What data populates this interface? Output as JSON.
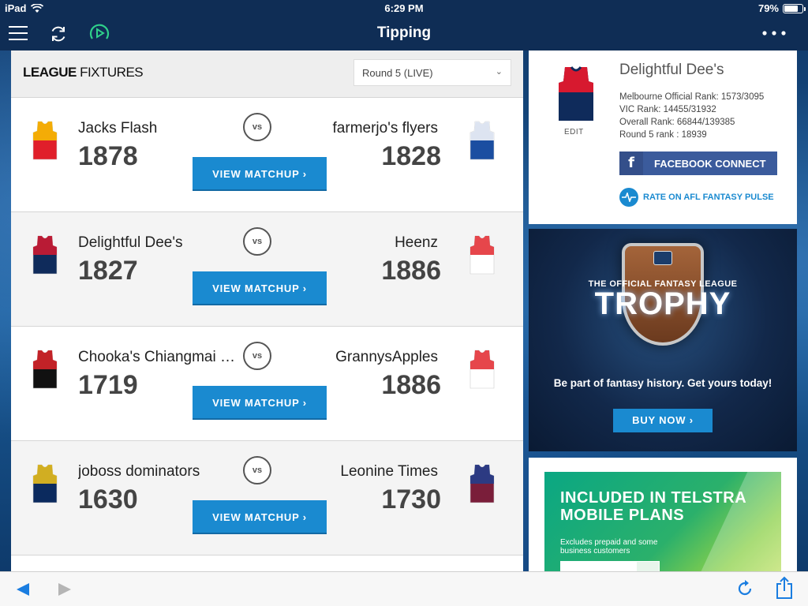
{
  "status_bar": {
    "device": "iPad",
    "time": "6:29 PM",
    "battery": "79%",
    "battery_level": 0.79
  },
  "app_bar": {
    "title": "Tipping",
    "icons": [
      "menu-icon",
      "refresh-icon",
      "play-icon",
      "more-icon"
    ]
  },
  "fixtures": {
    "title_bold": "LEAGUE",
    "title_rest": " FIXTURES",
    "round_select": "Round 5 (LIVE)",
    "vs_label": "vs",
    "button_label": "VIEW MATCHUP ›",
    "matches": [
      {
        "home": {
          "name": "Jacks Flash",
          "score": "1878",
          "jersey_colors": [
            "#e01f2a",
            "#f7c600"
          ]
        },
        "away": {
          "name": "farmerjo's flyers",
          "score": "1828",
          "jersey_colors": [
            "#1b4ea1",
            "#ffffff"
          ]
        }
      },
      {
        "home": {
          "name": "Delightful Dee's",
          "score": "1827",
          "jersey_colors": [
            "#0f2b5b",
            "#d7192f"
          ]
        },
        "away": {
          "name": "Heenz",
          "score": "1886",
          "jersey_colors": [
            "#ffffff",
            "#e2262b"
          ]
        }
      },
      {
        "home": {
          "name": "Chooka's Chiangmai Sa...",
          "score": "1719",
          "jersey_colors": [
            "#111111",
            "#e2262b"
          ]
        },
        "away": {
          "name": "GrannysApples",
          "score": "1886",
          "jersey_colors": [
            "#ffffff",
            "#e2262b"
          ]
        }
      },
      {
        "home": {
          "name": "joboss dominators",
          "score": "1630",
          "jersey_colors": [
            "#0b2a5e",
            "#f5c518"
          ]
        },
        "away": {
          "name": "Leonine Times",
          "score": "1730",
          "jersey_colors": [
            "#7a1e3a",
            "#1f3f8f"
          ]
        }
      }
    ]
  },
  "profile": {
    "team_name": "Delightful Dee's",
    "edit_label": "EDIT",
    "ranks": [
      "Melbourne Official Rank: 1573/3095",
      "VIC Rank: 14455/31932",
      "Overall Rank: 66844/139385",
      "Round 5 rank : 18939"
    ],
    "facebook_label": "FACEBOOK CONNECT",
    "pulse_label": "RATE ON AFL FANTASY PULSE"
  },
  "trophy_ad": {
    "subtitle": "THE OFFICIAL FANTASY LEAGUE",
    "headline": "TROPHY",
    "tagline": "Be part of fantasy history. Get yours today!",
    "button": "BUY NOW ›"
  },
  "telstra_ad": {
    "headline_line1": "INCLUDED IN TELSTRA",
    "headline_line2": "MOBILE PLANS",
    "sub_line1": "Excludes prepaid and some",
    "sub_line2": "business customers"
  },
  "colors": {
    "accent": "#1a8ad0",
    "header": "#0f2d55",
    "facebook": "#3b5b9c"
  }
}
